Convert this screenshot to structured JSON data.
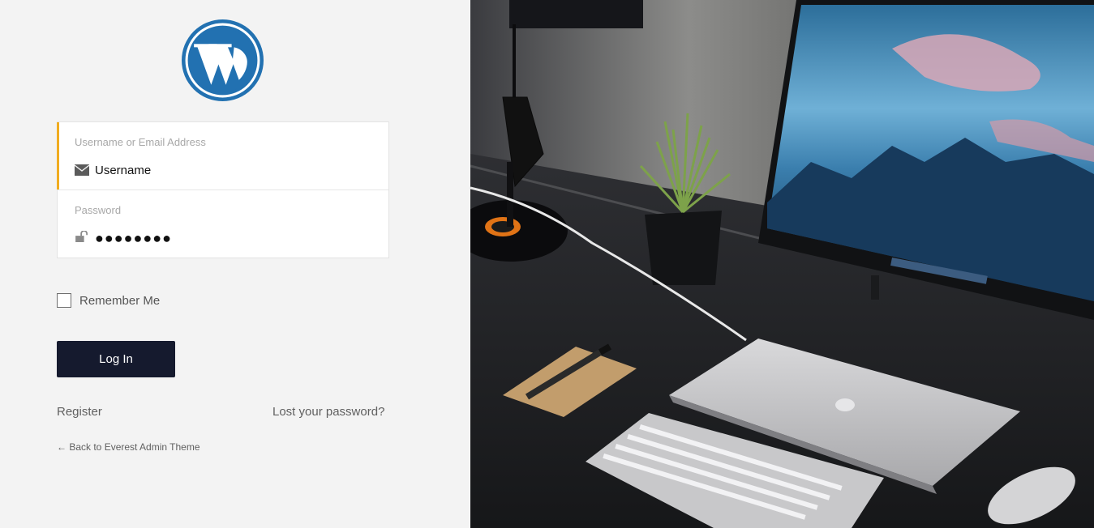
{
  "logo": {
    "icon": "wordpress-logo-icon",
    "color": "#2271b1"
  },
  "form": {
    "username": {
      "label": "Username or Email Address",
      "value": "Username",
      "icon": "envelope-icon"
    },
    "password": {
      "label": "Password",
      "value": "●●●●●●●●",
      "icon": "unlock-icon"
    }
  },
  "remember": {
    "label": "Remember Me",
    "checked": false
  },
  "login_button": {
    "label": "Log In"
  },
  "links": {
    "register": "Register",
    "lost_password": "Lost your password?",
    "back": "← Back to Everest Admin Theme"
  },
  "colors": {
    "accent": "#f0ac1f",
    "button": "#151a2e",
    "brand": "#2271b1"
  },
  "hero_image": {
    "icon": "desk-workspace-photo"
  }
}
